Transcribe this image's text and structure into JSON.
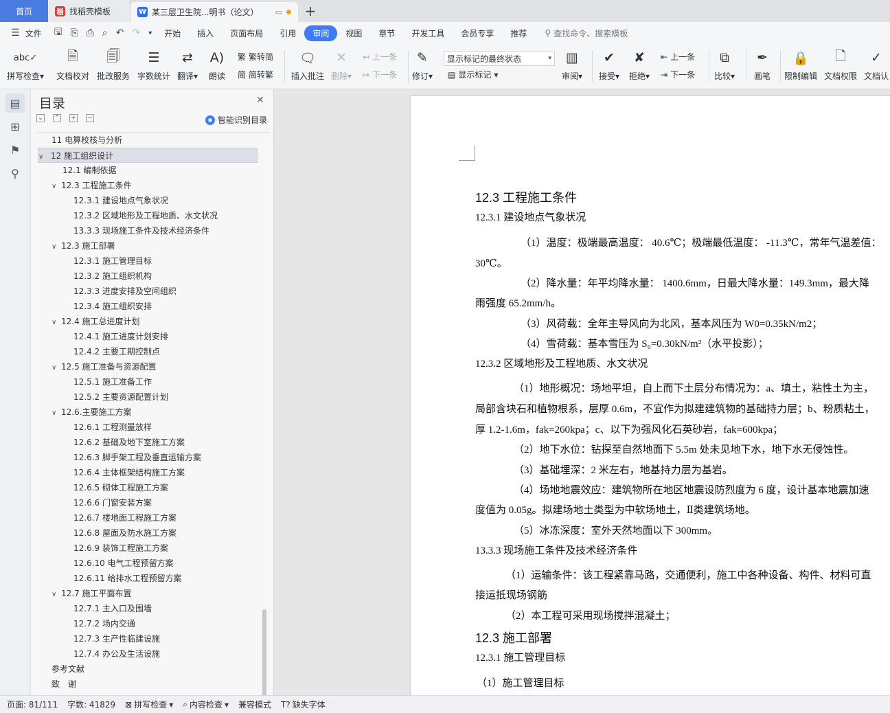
{
  "tabs": {
    "home": "首页",
    "docer": "找稻壳模板",
    "doc": "某三层卫生院...明书（论文）"
  },
  "menu": {
    "file": "文件",
    "items": [
      "开始",
      "插入",
      "页面布局",
      "引用",
      "审阅",
      "视图",
      "章节",
      "开发工具",
      "会员专享",
      "推荐"
    ],
    "search": "查找命令、搜索模板"
  },
  "ribbon": {
    "spell": "拼写检查",
    "doccheck": "文档校对",
    "batch": "批改服务",
    "wordcount": "字数统计",
    "translate": "翻译",
    "read": "朗读",
    "trad": "繁转简",
    "simp": "简转繁",
    "insert_comment": "插入批注",
    "delete": "删除",
    "prev_comment": "上一条",
    "next_comment": "下一条",
    "revise": "修订",
    "markup_state": "显示标记的最终状态",
    "show_markup": "显示标记",
    "review": "审阅",
    "accept": "接受",
    "reject": "拒绝",
    "prev_change": "上一条",
    "next_change": "下一条",
    "compare": "比较",
    "pen": "画笔",
    "restrict": "限制编辑",
    "permission": "文档权限",
    "certify": "文档认"
  },
  "toc": {
    "title": "目录",
    "smart": "智能识别目录",
    "items": [
      {
        "text": "11 电算校核与分析"
      },
      {
        "text": "12 施工组织设计"
      },
      {
        "text": "12.1 编制依据"
      },
      {
        "text": "12.3 工程施工条件"
      },
      {
        "text": "12.3.1 建设地点气象状况"
      },
      {
        "text": "12.3.2 区域地形及工程地质、水文状况"
      },
      {
        "text": "13.3.3 现场施工条件及技术经济条件"
      },
      {
        "text": "12.3 施工部署"
      },
      {
        "text": "12.3.1 施工管理目标"
      },
      {
        "text": "12.3.2 施工组织机构"
      },
      {
        "text": "12.3.3 进度安排及空间组织"
      },
      {
        "text": "12.3.4 施工组织安排"
      },
      {
        "text": "12.4 施工总进度计划"
      },
      {
        "text": "12.4.1 施工进度计划安排"
      },
      {
        "text": "12.4.2 主要工期控制点"
      },
      {
        "text": "12.5 施工准备与资源配置"
      },
      {
        "text": "12.5.1 施工准备工作"
      },
      {
        "text": "12.5.2 主要资源配置计划"
      },
      {
        "text": "12.6.主要施工方案"
      },
      {
        "text": "12.6.1 工程测量放样"
      },
      {
        "text": "12.6.2 基础及地下室施工方案"
      },
      {
        "text": "12.6.3 脚手架工程及垂直运输方案"
      },
      {
        "text": "12.6.4 主体框架结构施工方案"
      },
      {
        "text": "12.6.5 砌体工程施工方案"
      },
      {
        "text": "12.6.6 门窗安装方案"
      },
      {
        "text": "12.6.7 楼地面工程施工方案"
      },
      {
        "text": "12.6.8 屋面及防水施工方案"
      },
      {
        "text": "12.6.9 装饰工程施工方案"
      },
      {
        "text": "12.6.10 电气工程预留方案"
      },
      {
        "text": "12.6.11 给排水工程预留方案"
      },
      {
        "text": "12.7 施工平面布置"
      },
      {
        "text": "12.7.1 主入口及围墙"
      },
      {
        "text": "12.7.2 场内交通"
      },
      {
        "text": "12.7.3 生产性临建设施"
      },
      {
        "text": "12.7.4 办公及生活设施"
      },
      {
        "text": "参考文献"
      },
      {
        "text": "致　谢"
      }
    ]
  },
  "doc": {
    "lines": [
      "12.3 工程施工条件",
      "12.3.1 建设地点气象状况",
      "（1）温度：极端最高温度： 40.6℃；极端最低温度： -11.3℃，常年气温差值：",
      "30℃。",
      "（2）降水量：年平均降水量： 1400.6mm，日最大降水量：149.3mm，最大降",
      "雨强度 65.2mm/h。",
      "（3）风荷载：全年主导风向为北风，基本风压为 W0=0.35kN/m2；",
      "（4）雪荷载：基本雪压为 S₀=0.30kN/m²（水平投影）；",
      "12.3.2 区域地形及工程地质、水文状况",
      "（1）地形概况：场地平坦，自上而下土层分布情况为：a、填土，粘性土为主，",
      "局部含块石和植物根系，层厚 0.6m，不宜作为拟建建筑物的基础持力层；b、粉质粘土，",
      "厚 1.2-1.6m，fak=260kpa；c、以下为强风化石英砂岩，fak=600kpa；",
      "（2）地下水位：钻探至自然地面下 5.5m 处未见地下水，地下水无侵蚀性。",
      "（3）基础埋深：2 米左右，地基持力层为基岩。",
      "（4）场地地震效应：建筑物所在地区地震设防烈度为 6 度，设计基本地震加速",
      "度值为 0.05g。拟建场地土类型为中软场地土，Ⅱ类建筑场地。",
      "（5）冰冻深度：室外天然地面以下 300mm。",
      "13.3.3 现场施工条件及技术经济条件",
      "（1）运输条件：该工程紧靠马路，交通便利，施工中各种设备、构件、材料可直",
      "接运抵现场钢筋",
      "（2）本工程可采用现场搅拌混凝土；",
      "12.3 施工部署",
      "12.3.1 施工管理目标",
      "（1）施工管理目标"
    ]
  },
  "status": {
    "page": "页面: 81/111",
    "words": "字数: 41829",
    "spell": "拼写检查",
    "content": "内容检查",
    "compat": "兼容模式",
    "font": "缺失字体"
  }
}
